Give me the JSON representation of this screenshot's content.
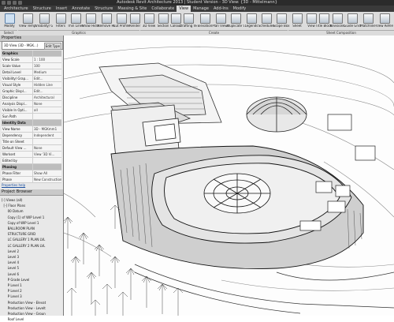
{
  "window": {
    "title": "Autodesk Revit Architecture 2013 | Student Version - 3D View: {3D - Mittelmann}"
  },
  "tabs": [
    "Architecture",
    "Structure",
    "Insert",
    "Annotate",
    "Structure",
    "Massing & Site",
    "Collaborate",
    "View",
    "Manage",
    "Add-Ins",
    "Modify"
  ],
  "active_tab": "View",
  "ribbon": {
    "buttons": [
      "Modify",
      "View Templates",
      "Visibility/ Graphics",
      "Filters",
      "Thin Lines",
      "Show Hidden Lines",
      "Remove Hidden Lines",
      "Cut Profile",
      "Render",
      "3D View",
      "Section",
      "Callout",
      "Drafting View",
      "Elevation",
      "Plan Views",
      "Duplicate View",
      "Legends",
      "Schedules",
      "Scope Box",
      "Sheet",
      "View",
      "Title Block",
      "Revisions",
      "Guide Grid",
      "Matchline",
      "View Reference"
    ],
    "panels": [
      "Select",
      "Graphics",
      "Create",
      "Sheet Composition"
    ]
  },
  "properties": {
    "header": "Properties",
    "type": "3D View (3D - MGK...)",
    "edit_type": "Edit Type",
    "rows": [
      {
        "k": "Graphics",
        "v": "",
        "sec": true
      },
      {
        "k": "View Scale",
        "v": "1 : 100"
      },
      {
        "k": "Scale Value",
        "v": "100"
      },
      {
        "k": "Detail Level",
        "v": "Medium"
      },
      {
        "k": "Visibility/ Grap...",
        "v": "Edit..."
      },
      {
        "k": "Visual Style",
        "v": "Hidden Line"
      },
      {
        "k": "Graphic Displ...",
        "v": "Edit..."
      },
      {
        "k": "Discipline",
        "v": "Architectural"
      },
      {
        "k": "Analysis Displ...",
        "v": "None"
      },
      {
        "k": "Visible In Opti...",
        "v": "all"
      },
      {
        "k": "Sun Path",
        "v": ""
      },
      {
        "k": "Identity Data",
        "v": "",
        "sec": true
      },
      {
        "k": "View Name",
        "v": "3D - MGKmm1"
      },
      {
        "k": "Dependency",
        "v": "Independent"
      },
      {
        "k": "Title on Sheet",
        "v": ""
      },
      {
        "k": "Default View ...",
        "v": "None"
      },
      {
        "k": "Workset",
        "v": "View '3D Vi..."
      },
      {
        "k": "Edited by",
        "v": ""
      },
      {
        "k": "Phasing",
        "v": "",
        "sec": true
      },
      {
        "k": "Phase Filter",
        "v": "Show All"
      },
      {
        "k": "Phase",
        "v": "New Construction"
      }
    ],
    "help": "Properties help",
    "apply": "Apply"
  },
  "browser": {
    "header": "Project Browser",
    "items": [
      "[-] Views (all)",
      "  [-] Floor Plans",
      "      00 Datum",
      "      Copy (1) of WIP Level 1",
      "      Copy of WIP Level 1",
      "      BALLROOM PLAN",
      "      STRUCTURE GRID",
      "      LC GALLERY 1 PLAN LVL",
      "      LC GALLERY 2 PLAN LVL",
      "      Level 2",
      "      Level 3",
      "      Level 4",
      "      Level 5",
      "      Level 6",
      "      P Grade Level",
      "      P Level 1",
      "      P Level 2",
      "      P Level 3",
      "      Production View - Elevat",
      "      Production View - Levelt",
      "      Production View - Groun",
      "      Roof Level"
    ]
  }
}
